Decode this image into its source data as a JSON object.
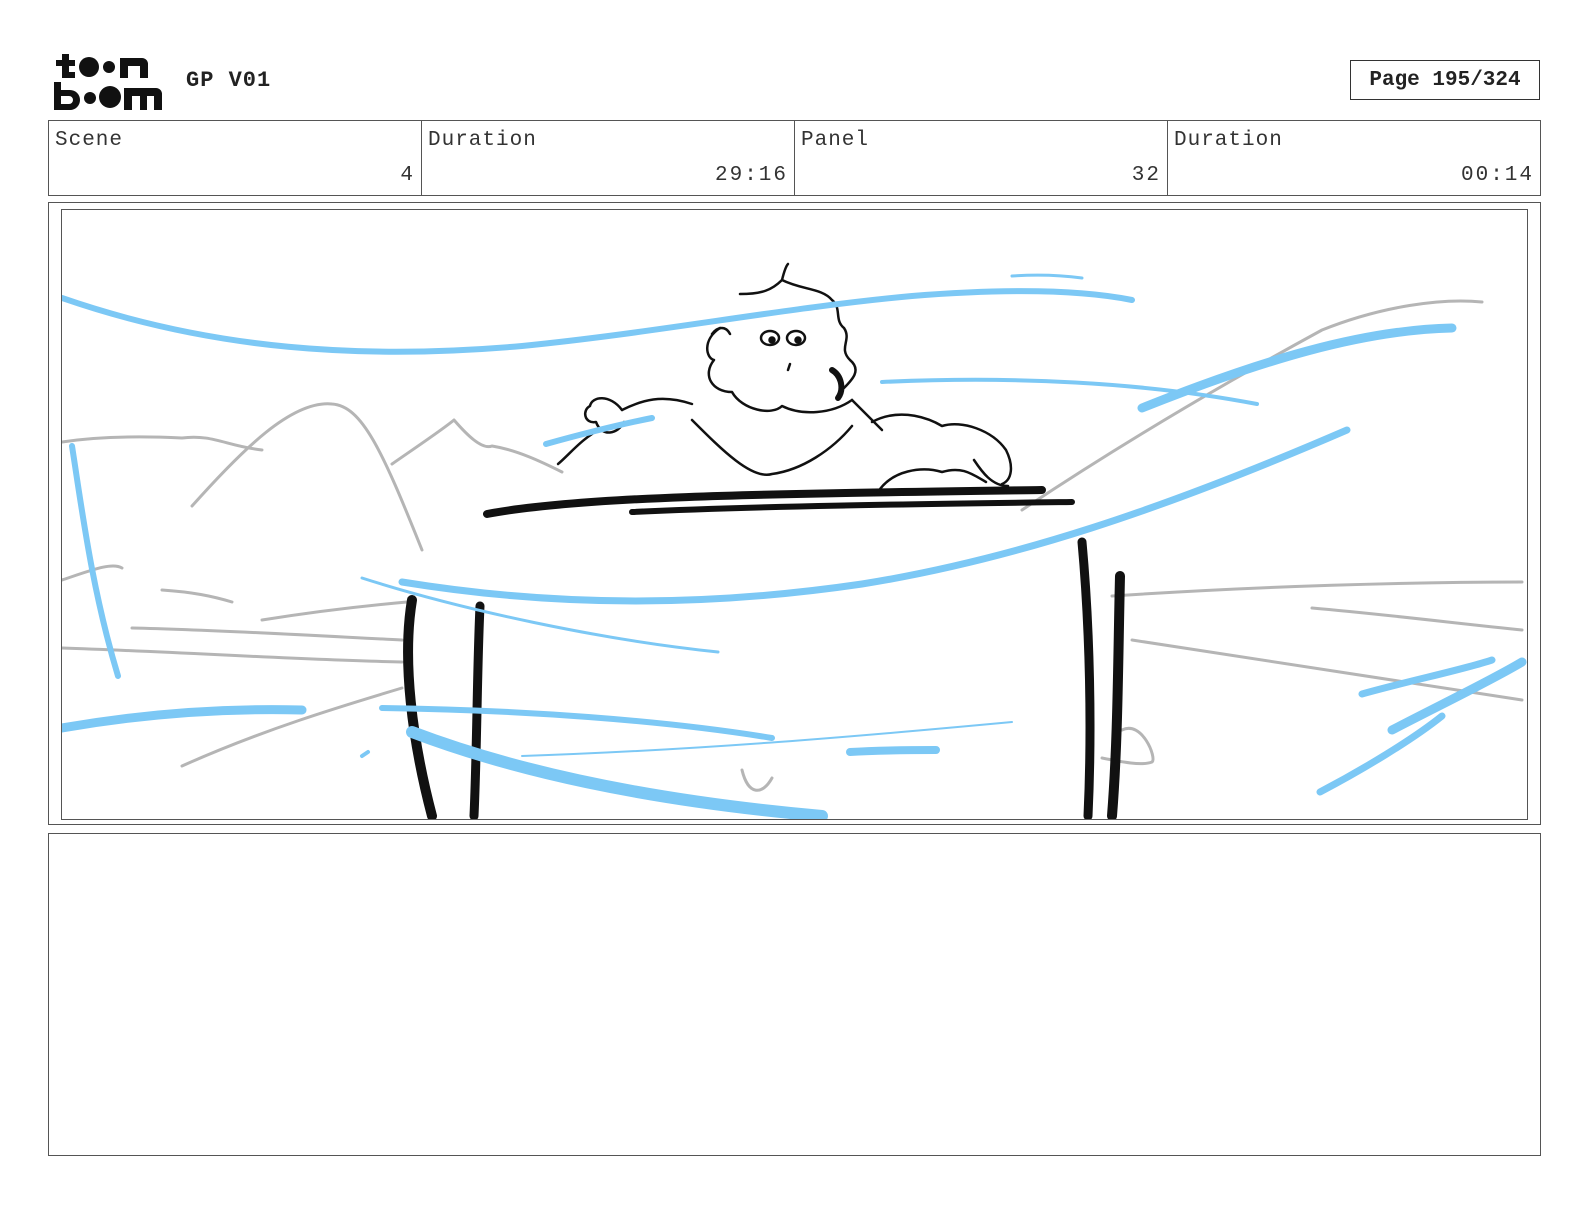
{
  "header": {
    "project_title": "GP V01",
    "page_label": "Page 195/324",
    "logo_icon": "toon-boom-logo"
  },
  "info": {
    "scene": {
      "label": "Scene",
      "value": "4"
    },
    "scene_duration": {
      "label": "Duration",
      "value": "29:16"
    },
    "panel": {
      "label": "Panel",
      "value": "32"
    },
    "panel_duration": {
      "label": "Duration",
      "value": "00:14"
    }
  },
  "panel_image": {
    "icon": "storyboard-sketch-icon",
    "colors": {
      "line": "#111111",
      "background_line": "#b5b5b5",
      "motion_line": "#7cc8f5"
    }
  },
  "notes": {
    "text": ""
  }
}
